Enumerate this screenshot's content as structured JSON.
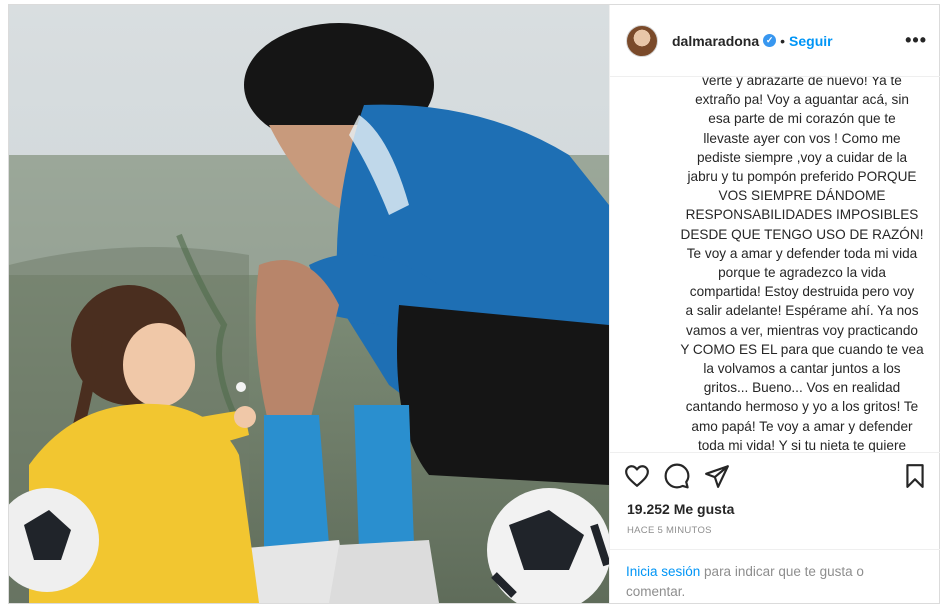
{
  "post": {
    "username": "dalmaradona",
    "follow_label": "Seguir",
    "separator": "•",
    "verified_glyph": "✓",
    "more_glyph": "•••",
    "caption": "verte y abrazarte de nuevo! Ya te\nextraño pa! Voy a aguantar acá, sin\nesa parte de mi corazón que te\nllevaste ayer con vos ! Como me\npediste siempre ,voy a cuidar de la\njabru y tu pompón preferido PORQUE\nVOS SIEMPRE DÁNDOME\nRESPONSABILIDADES IMPOSIBLES\nDESDE QUE TENGO USO DE RAZÓN!\nTe voy a amar y defender toda mi vida\nporque te agradezco la vida\ncompartida! Estoy destruida pero voy\na salir adelante! Espérame ahí. Ya nos\nvamos a ver, mientras voy practicando\nY COMO ES EL para que cuando te vea\nla volvamos a cantar juntos a los\ngritos... Bueno... Vos en realidad\ncantando hermoso y yo a los gritos! Te\namo papá! Te voy a amar y defender\ntoda mi vida! Y si tu nieta te quiere\nllamar por videollamada como hacían,",
    "likes": "19.252 Me gusta",
    "timestamp": "HACE 5 MINUTOS",
    "login_link": "Inicia sesión",
    "login_text": " para indicar que te gusta o\ncomentar."
  },
  "icons": {
    "like": "heart-icon",
    "comment": "comment-icon",
    "share": "share-icon",
    "save": "bookmark-icon",
    "more": "more-options-icon"
  },
  "colors": {
    "accent": "#0095f6",
    "verified": "#3897f0",
    "muted": "#8e8e8e",
    "text": "#262626"
  }
}
